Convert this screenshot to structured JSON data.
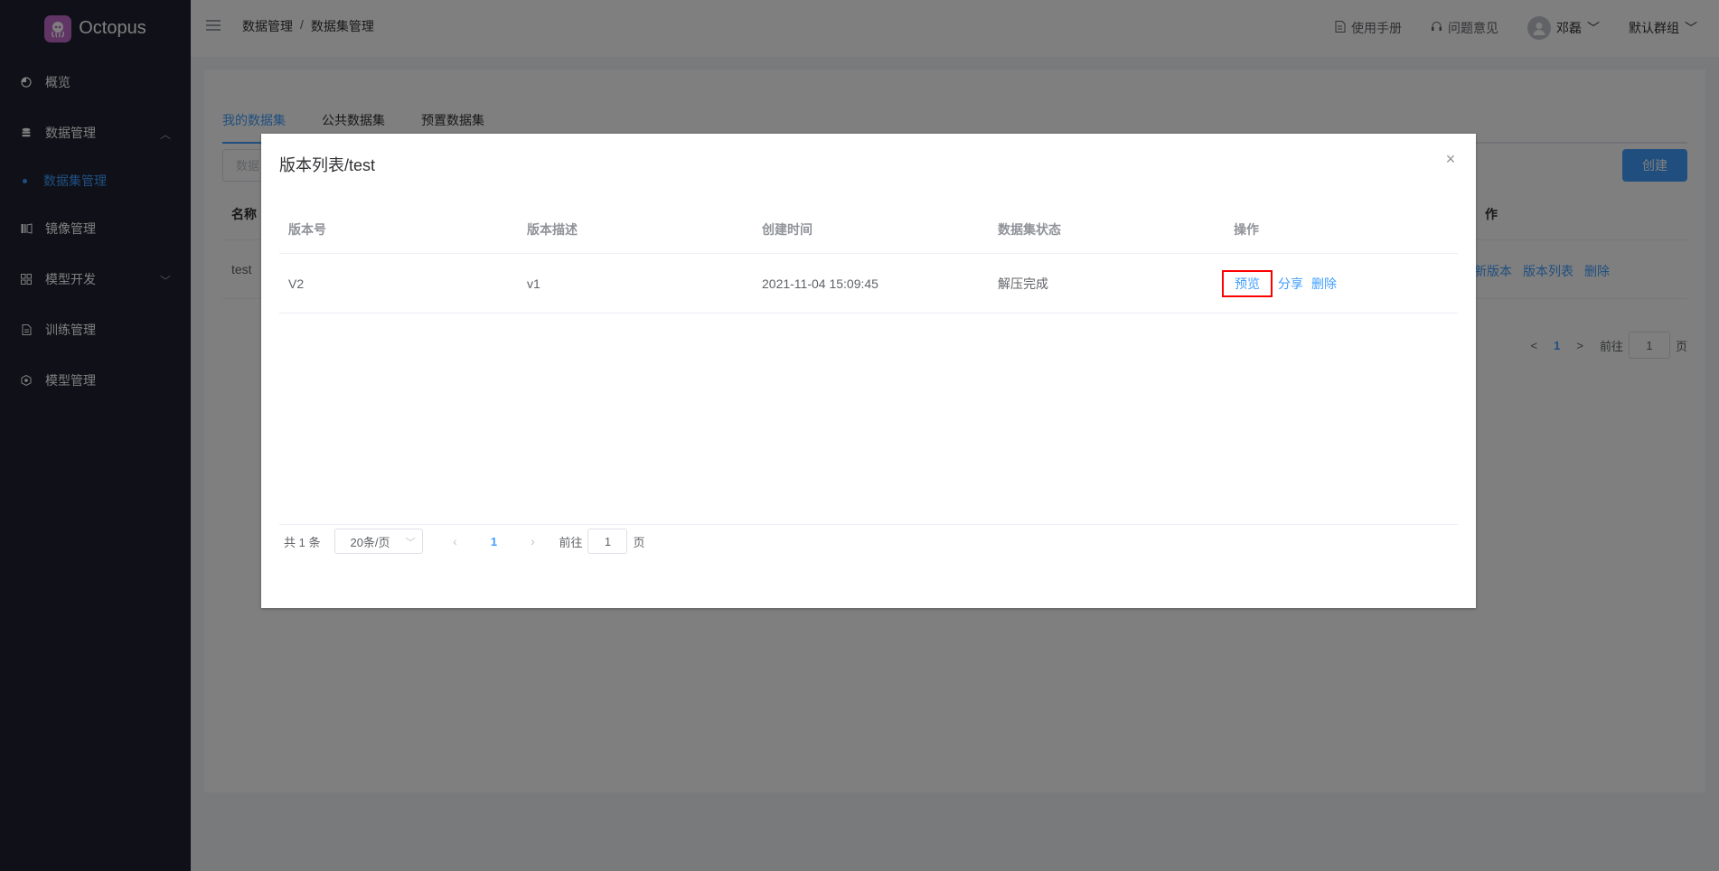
{
  "app": {
    "name": "Octopus"
  },
  "sidebar": {
    "items": [
      {
        "label": "概览",
        "icon": "dashboard-icon"
      },
      {
        "label": "数据管理",
        "icon": "database-icon",
        "expanded": true
      },
      {
        "label": "镜像管理",
        "icon": "image-icon"
      },
      {
        "label": "模型开发",
        "icon": "grid-icon"
      },
      {
        "label": "训练管理",
        "icon": "document-icon"
      },
      {
        "label": "模型管理",
        "icon": "cube-icon"
      }
    ],
    "submenu": [
      {
        "label": "数据集管理",
        "active": true
      }
    ]
  },
  "header": {
    "breadcrumb": [
      "数据管理",
      "数据集管理"
    ],
    "breadcrumb_sep": "/",
    "manual": "使用手册",
    "feedback": "问题意见",
    "user_name": "邓磊",
    "group": "默认群组"
  },
  "page": {
    "tabs": [
      "我的数据集",
      "公共数据集",
      "预置数据集"
    ],
    "active_tab": 0,
    "search_placeholder": "数据",
    "create_label": "创建",
    "table": {
      "headers": [
        "名称",
        "作"
      ],
      "rows": [
        {
          "name": "test",
          "ops": [
            "建新版本",
            "版本列表",
            "删除"
          ]
        }
      ]
    },
    "pager": {
      "current": "1",
      "jump_label": "前往",
      "jump_value": "1",
      "page_unit": "页"
    }
  },
  "dialog": {
    "title": "版本列表/test",
    "close": "×",
    "table": {
      "headers": [
        "版本号",
        "版本描述",
        "创建时间",
        "数据集状态",
        "操作"
      ],
      "rows": [
        {
          "version": "V2",
          "description": "v1",
          "created": "2021-11-04 15:09:45",
          "status": "解压完成",
          "ops": [
            "预览",
            "分享",
            "删除"
          ]
        }
      ]
    },
    "pager": {
      "total": "共 1 条",
      "page_size": "20条/页",
      "current": "1",
      "jump_label": "前往",
      "jump_value": "1",
      "page_unit": "页"
    }
  },
  "colors": {
    "sidebar_bg": "#1e2130",
    "accent": "#409eff",
    "highlight_box": "#ff0000"
  }
}
